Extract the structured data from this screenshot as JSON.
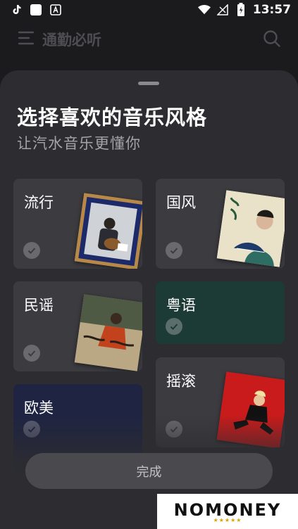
{
  "statusbar": {
    "time": "13:57",
    "icons_left": [
      "tiktok-icon",
      "app-square-icon",
      "font-app-icon"
    ],
    "icons_right": [
      "wifi-icon",
      "signal-icon",
      "battery-icon"
    ]
  },
  "app_header": {
    "title": "通勤必听"
  },
  "sheet": {
    "title": "选择喜欢的音乐风格",
    "subtitle": "让汽水音乐更懂你"
  },
  "genres": [
    {
      "label": "流行",
      "color": "#3c3b40",
      "selected": false
    },
    {
      "label": "国风",
      "color": "#3c3b40",
      "selected": false
    },
    {
      "label": "民谣",
      "color": "#3c3b40",
      "selected": false
    },
    {
      "label": "粤语",
      "color": "#1c3a36",
      "selected": false
    },
    {
      "label": "欧美",
      "color": "#1e2442",
      "selected": false
    },
    {
      "label": "摇滚",
      "color": "#3c3b40",
      "selected": false
    }
  ],
  "done_button": {
    "label": "完成"
  },
  "watermark": {
    "text": "NOMONEY",
    "stars": "★★★★★"
  },
  "colors": {
    "background": "#1b1b1d",
    "sheet": "#2d2c30",
    "card": "#3c3b40",
    "cantonese_card": "#1c3a36",
    "western_card": "#1e2442"
  }
}
